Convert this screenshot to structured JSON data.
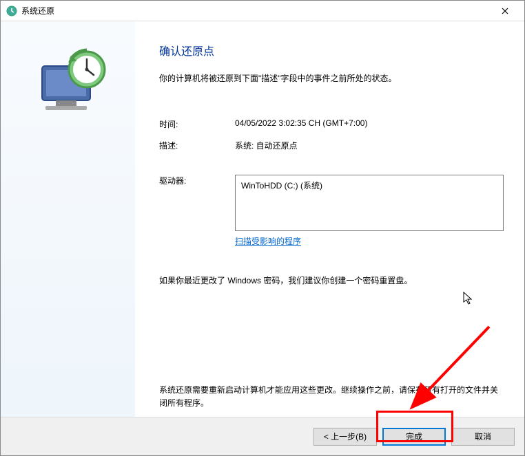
{
  "title": "系统还原",
  "heading": "确认还原点",
  "subheading": "你的计算机将被还原到下面\"描述\"字段中的事件之前所处的状态。",
  "time_label": "时间:",
  "time_value": "04/05/2022 3:02:35 CH (GMT+7:00)",
  "desc_label": "描述:",
  "desc_value": "系统: 自动还原点",
  "drives_label": "驱动器:",
  "drives_value": "WinToHDD (C:) (系统)",
  "scan_link": "扫描受影响的程序",
  "warning_password": "如果你最近更改了 Windows 密码，我们建议你创建一个密码重置盘。",
  "warning_restart": "系统还原需要重新启动计算机才能应用这些更改。继续操作之前，请保存所有打开的文件并关闭所有程序。",
  "btn_back": "< 上一步(B)",
  "btn_finish": "完成",
  "btn_cancel": "取消"
}
